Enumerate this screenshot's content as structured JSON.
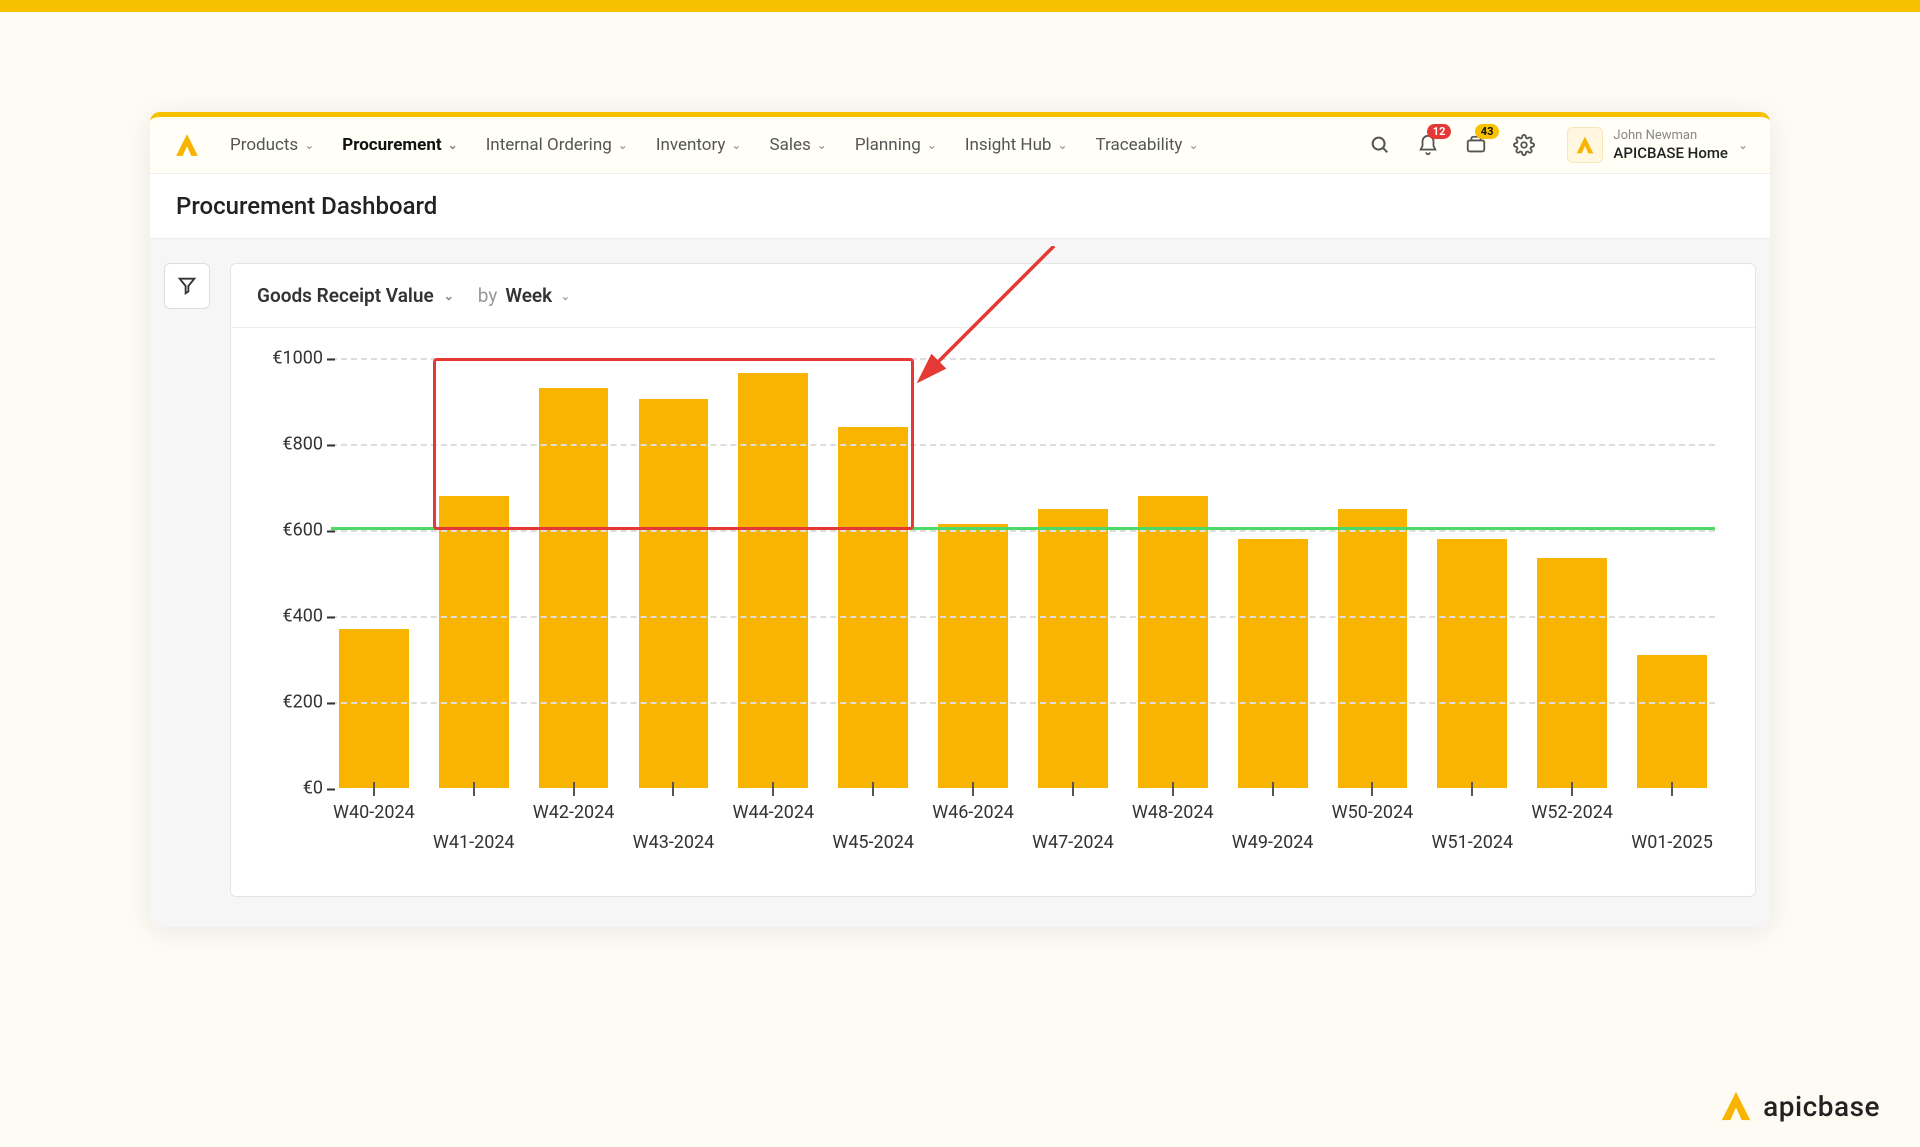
{
  "nav": {
    "items": [
      {
        "label": "Products",
        "active": false
      },
      {
        "label": "Procurement",
        "active": true
      },
      {
        "label": "Internal Ordering",
        "active": false
      },
      {
        "label": "Inventory",
        "active": false
      },
      {
        "label": "Sales",
        "active": false
      },
      {
        "label": "Planning",
        "active": false
      },
      {
        "label": "Insight Hub",
        "active": false
      },
      {
        "label": "Traceability",
        "active": false
      }
    ],
    "notifications_badge": "12",
    "orders_badge": "43"
  },
  "user": {
    "name": "John Newman",
    "org": "APICBASE Home"
  },
  "page": {
    "title": "Procurement Dashboard"
  },
  "chart_controls": {
    "metric": "Goods Receipt Value",
    "by_label": "by",
    "by_value": "Week"
  },
  "chart_data": {
    "type": "bar",
    "title": "Goods Receipt Value",
    "xlabel": "",
    "ylabel": "",
    "currency": "€",
    "ylim": [
      0,
      1000
    ],
    "y_ticks": [
      0,
      200,
      400,
      600,
      800,
      1000
    ],
    "y_tick_labels": [
      "€0",
      "€200",
      "€400",
      "€600",
      "€800",
      "€1000"
    ],
    "reference_line": 600,
    "reference_line_color": "#4cd964",
    "highlight_range": [
      "W41-2024",
      "W45-2024"
    ],
    "categories": [
      "W40-2024",
      "W41-2024",
      "W42-2024",
      "W43-2024",
      "W44-2024",
      "W45-2024",
      "W46-2024",
      "W47-2024",
      "W48-2024",
      "W49-2024",
      "W50-2024",
      "W51-2024",
      "W52-2024",
      "W01-2025"
    ],
    "values": [
      370,
      680,
      930,
      905,
      965,
      840,
      615,
      650,
      680,
      580,
      650,
      580,
      535,
      310
    ]
  },
  "branding": {
    "name": "apicbase"
  }
}
